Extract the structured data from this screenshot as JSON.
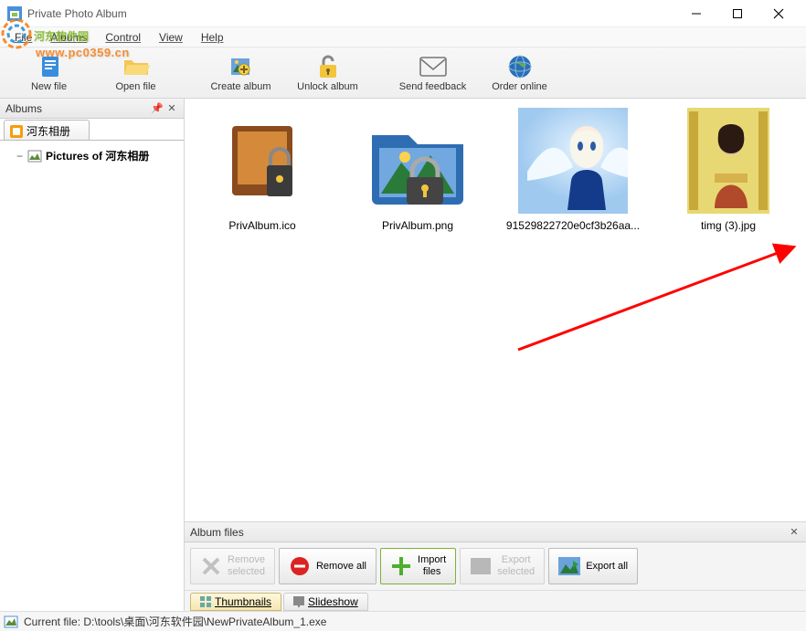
{
  "window": {
    "title": "Private Photo Album"
  },
  "watermark": {
    "text": "河东软件园",
    "url": "www.pc0359.cn"
  },
  "menu": {
    "file": "File",
    "albums": "Albums",
    "control": "Control",
    "view": "View",
    "help": "Help"
  },
  "toolbar": {
    "newfile": "New file",
    "openfile": "Open file",
    "createalbum": "Create album",
    "unlockalbum": "Unlock album",
    "sendfeedback": "Send feedback",
    "orderonline": "Order online"
  },
  "sidebar": {
    "header": "Albums",
    "tab_label": "河东相册",
    "tree_item": "Pictures of 河东相册"
  },
  "thumbs": [
    {
      "label": "PrivAlbum.ico"
    },
    {
      "label": "PrivAlbum.png"
    },
    {
      "label": "91529822720e0cf3b26aa..."
    },
    {
      "label": "timg (3).jpg"
    }
  ],
  "albumfiles": {
    "header": "Album files",
    "remove_selected": "Remove\nselected",
    "remove_all": "Remove all",
    "import_files": "Import\nfiles",
    "export_selected": "Export\nselected",
    "export_all": "Export all",
    "tab_thumbs": "Thumbnails",
    "tab_slide": "Slideshow"
  },
  "status": {
    "text": "Current file: D:\\tools\\桌面\\河东软件园\\NewPrivateAlbum_1.exe"
  }
}
